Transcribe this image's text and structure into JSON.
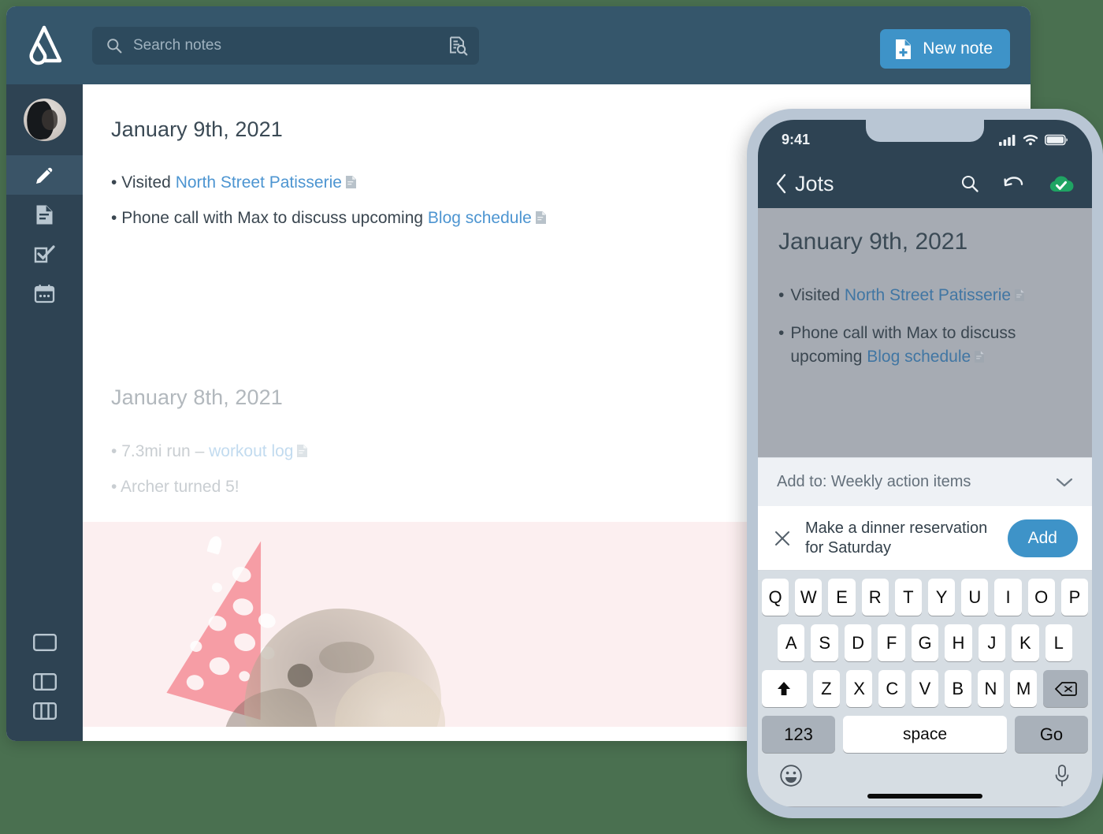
{
  "theme": {
    "page_background": "#4a7050",
    "header_bg": "#35566b",
    "sidebar_bg": "#2e4353",
    "accent_blue": "#3e93c8",
    "link_blue": "#4d95d1",
    "cloud_green": "#1fa463"
  },
  "desktop": {
    "logo_icon": "paperclip-pen-logo",
    "search": {
      "icon": "search-icon",
      "placeholder": "Search notes",
      "value": "",
      "advanced_icon": "document-search-icon"
    },
    "new_note": {
      "label": "New note",
      "icon": "document-plus-icon"
    },
    "sidebar": {
      "avatar": "user-avatar",
      "items": [
        {
          "name": "notes",
          "icon": "pencil-icon",
          "active": true
        },
        {
          "name": "documents",
          "icon": "document-icon",
          "active": false
        },
        {
          "name": "tasks",
          "icon": "checkbox-icon",
          "active": false
        },
        {
          "name": "calendar",
          "icon": "calendar-icon",
          "active": false
        }
      ],
      "layout_items": [
        {
          "name": "single-pane",
          "icon": "layout-single-icon"
        },
        {
          "name": "two-pane",
          "icon": "layout-sidebar-icon"
        },
        {
          "name": "three-pane",
          "icon": "layout-columns-icon"
        }
      ]
    },
    "notes": [
      {
        "date": "January 9th, 2021",
        "faded": false,
        "lines": [
          {
            "bullet": "•",
            "pre": "Visited ",
            "link": "North Street Patisserie",
            "post": "",
            "doc_icon": "document-link-icon"
          },
          {
            "bullet": "•",
            "pre": "Phone call with Max to discuss upcoming ",
            "link": "Blog schedule",
            "post": "",
            "doc_icon": "document-link-icon"
          }
        ]
      },
      {
        "date": "January 8th, 2021",
        "faded": true,
        "lines": [
          {
            "bullet": "•",
            "pre": "7.3mi run – ",
            "link": "workout log",
            "post": "",
            "doc_icon": "document-link-icon"
          },
          {
            "bullet": "•",
            "pre": "Archer turned 5!",
            "link": "",
            "post": "",
            "doc_icon": ""
          }
        ],
        "attachment": {
          "name": "pug-birthday-photo",
          "alt": "Pug wearing red polka-dot party hat"
        }
      }
    ]
  },
  "phone": {
    "status_bar": {
      "time": "9:41",
      "icons": [
        "cellular-signal-icon",
        "wifi-icon",
        "battery-icon"
      ]
    },
    "nav_bar": {
      "back_icon": "chevron-left-icon",
      "title": "Jots",
      "actions": [
        "search-icon",
        "undo-icon",
        "cloud-synced-icon"
      ]
    },
    "note": {
      "date": "January 9th, 2021",
      "lines": [
        {
          "bullet": "•",
          "pre": "Visited ",
          "link": "North Street Patisserie",
          "post": "",
          "doc_icon": "document-link-icon"
        },
        {
          "bullet": "•",
          "pre": "Phone call with Max to discuss upcoming ",
          "link": "Blog schedule",
          "post": "",
          "doc_icon": "document-link-icon"
        }
      ]
    },
    "add_to": {
      "label": "Add to: Weekly action items",
      "chevron_icon": "chevron-down-icon"
    },
    "suggestion": {
      "dismiss_icon": "close-icon",
      "text": "Make a dinner reservation for Saturday",
      "add_label": "Add"
    },
    "keyboard": {
      "row1": [
        "Q",
        "W",
        "E",
        "R",
        "T",
        "Y",
        "U",
        "I",
        "O",
        "P"
      ],
      "row2": [
        "A",
        "S",
        "D",
        "F",
        "G",
        "H",
        "J",
        "K",
        "L"
      ],
      "row3_letters": [
        "Z",
        "X",
        "C",
        "V",
        "B",
        "N",
        "M"
      ],
      "shift_icon": "shift-icon",
      "backspace_icon": "backspace-icon",
      "numbers_label": "123",
      "space_label": "space",
      "return_label": "Go",
      "emoji_icon": "emoji-icon",
      "dictation_icon": "microphone-icon"
    }
  }
}
